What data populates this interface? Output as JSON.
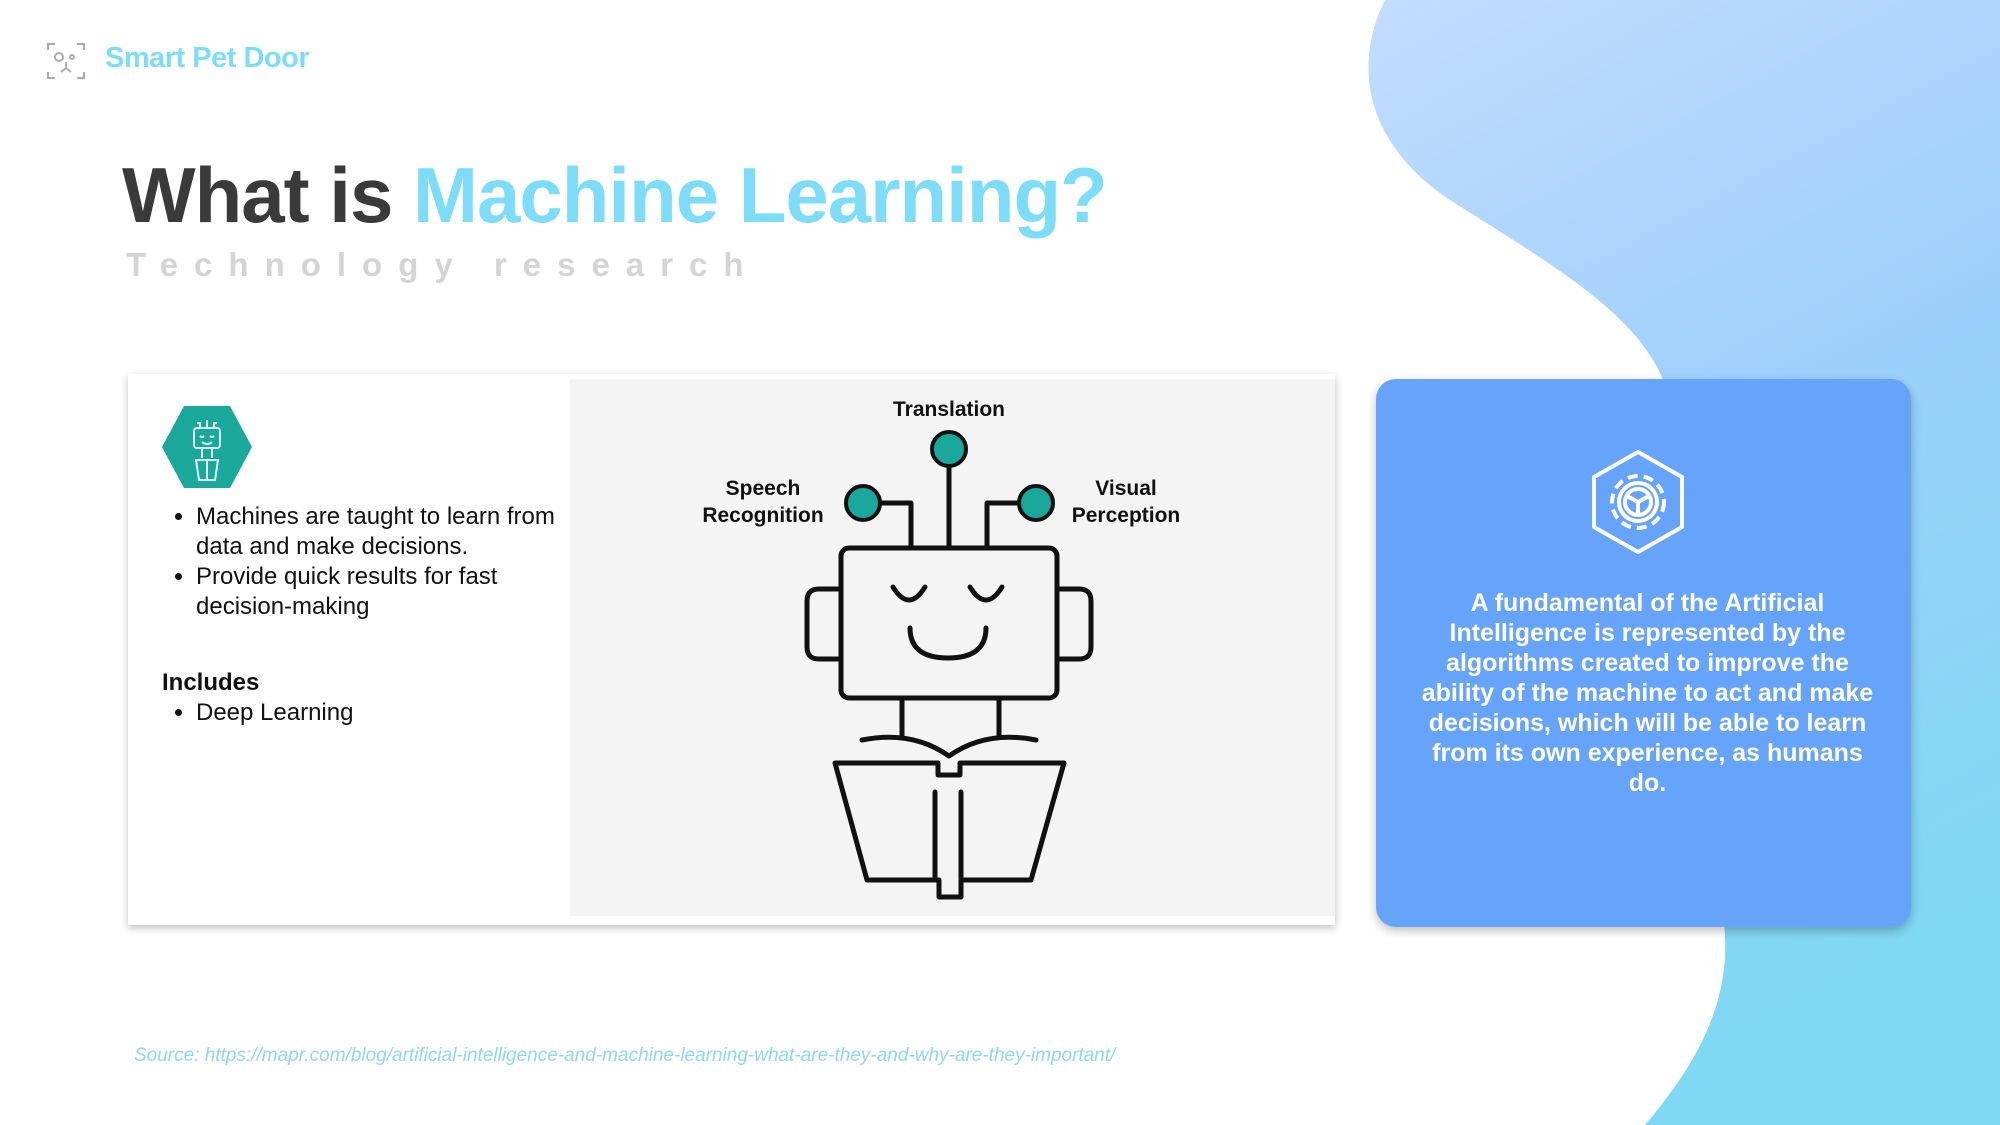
{
  "brand": {
    "name": "Smart Pet Door",
    "icon": "pet-face-scan-icon"
  },
  "header": {
    "title_prefix": "What is ",
    "title_accent": "Machine Learning?",
    "subtitle": "Technology research"
  },
  "left_card": {
    "icon": "robot-reading-hexagon-icon",
    "bullets": [
      "Machines are taught to learn from data and make decisions.",
      "Provide quick results for fast decision-making"
    ],
    "includes_title": "Includes",
    "includes": [
      "Deep Learning"
    ]
  },
  "diagram": {
    "labels": {
      "top": "Translation",
      "left_line1": "Speech",
      "left_line2": "Recognition",
      "right_line1": "Visual",
      "right_line2": "Perception"
    },
    "node_color": "#1aa89a"
  },
  "right_card": {
    "icon": "gear-hexagon-icon",
    "text": "A fundamental of the Artificial Intelligence is represented by the algorithms created to improve the ability of the machine to act and make decisions, which will be able to learn from its own experience, as humans do.",
    "color": "#66a3fb"
  },
  "source": "Source: https://mapr.com/blog/artificial-intelligence-and-machine-learning-what-are-they-and-why-are-they-important/",
  "colors": {
    "accent": "#7ddcf8",
    "teal": "#1aa89a"
  }
}
